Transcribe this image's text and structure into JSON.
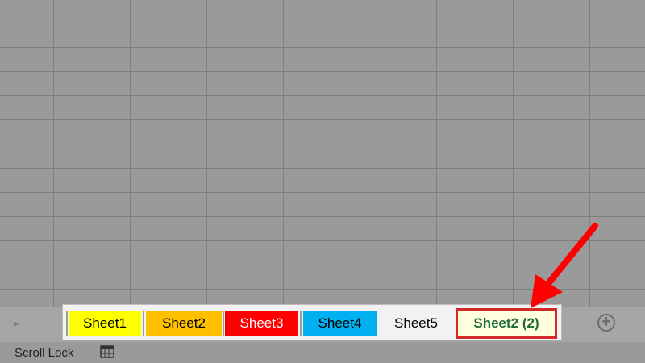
{
  "sheet_tabs": [
    {
      "label": "Sheet1",
      "color": "#ffff00",
      "text_color": "#000000"
    },
    {
      "label": "Sheet2",
      "color": "#ffc000",
      "text_color": "#000000"
    },
    {
      "label": "Sheet3",
      "color": "#ff0000",
      "text_color": "#ffffff"
    },
    {
      "label": "Sheet4",
      "color": "#00b0f0",
      "text_color": "#000000"
    },
    {
      "label": "Sheet5",
      "color": "#f2f2f2",
      "text_color": "#000000"
    },
    {
      "label": "Sheet2 (2)",
      "color": "#ffffe0",
      "text_color": "#1f6b3a",
      "active": true
    }
  ],
  "add_sheet": {
    "icon": "plus-circle-icon",
    "symbol": "+"
  },
  "nav": {
    "icon": "scroll-right-icon",
    "symbol": "▸"
  },
  "status": {
    "text": "Scroll Lock",
    "icon": "page-layout-icon"
  },
  "annotation": {
    "icon": "red-arrow-icon",
    "color": "#ff0000"
  }
}
